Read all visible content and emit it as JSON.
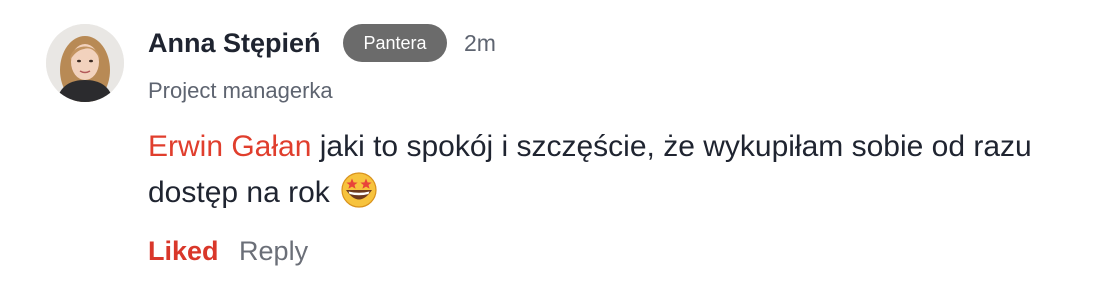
{
  "comment": {
    "author": "Anna Stępień",
    "badge": "Pantera",
    "timestamp": "2m",
    "subtitle": "Project managerka",
    "mention": "Erwin Gałan",
    "text": " jaki to spokój i szczęście, że wykupiłam sobie od razu dostęp na rok ",
    "emoji": "star-struck-emoji-icon",
    "actions": {
      "liked_label": "Liked",
      "reply_label": "Reply"
    }
  },
  "colors": {
    "mention": "#e03e2d",
    "liked": "#d9372a",
    "badge_bg": "#6b6b6b",
    "text": "#1f2430",
    "muted": "#5e6470"
  }
}
